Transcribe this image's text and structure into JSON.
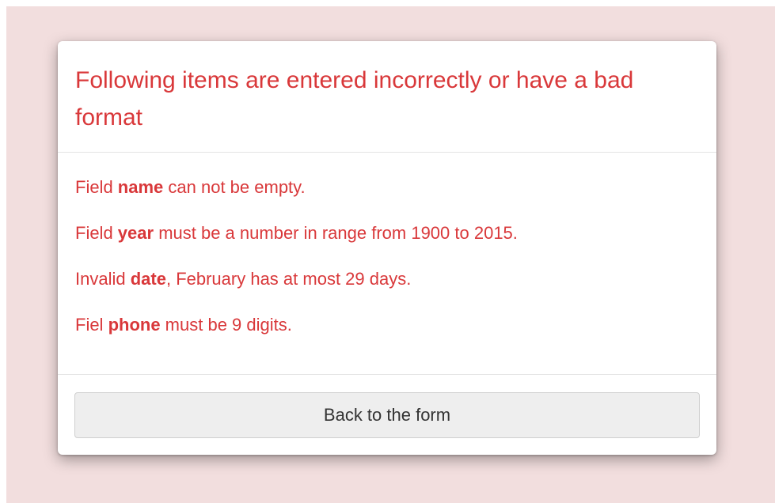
{
  "dialog": {
    "title": "Following items are entered incorrectly or have a bad format",
    "errors": [
      {
        "prefix": "Field ",
        "field": "name",
        "suffix": " can not be empty."
      },
      {
        "prefix": "Field ",
        "field": "year",
        "suffix": " must be a number in range from 1900 to 2015."
      },
      {
        "prefix": "Invalid ",
        "field": "date",
        "suffix": ", February has at most 29 days."
      },
      {
        "prefix": "Fiel ",
        "field": "phone",
        "suffix": " must be 9 digits."
      }
    ],
    "back_button_label": "Back to the form"
  },
  "colors": {
    "backdrop": "#f2dede",
    "error_text": "#d9383a",
    "button_bg": "#eeeeee"
  }
}
